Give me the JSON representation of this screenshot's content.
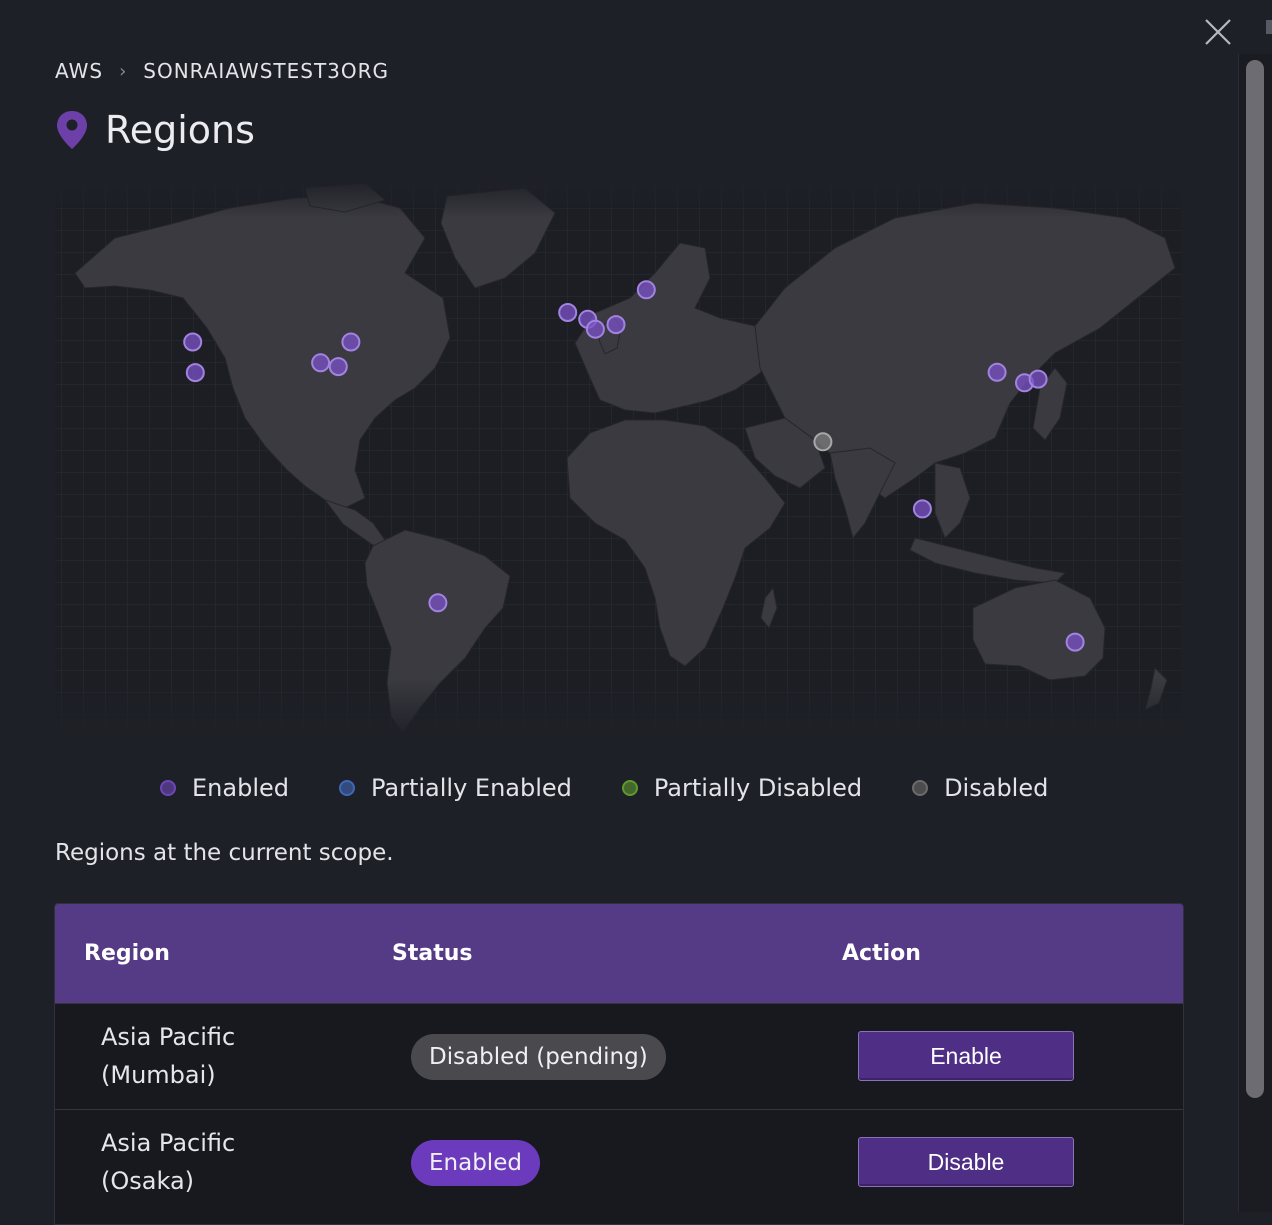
{
  "breadcrumb": {
    "items": [
      "AWS",
      "SONRAIAWSTEST3ORG"
    ],
    "separator": "›"
  },
  "page": {
    "title": "Regions",
    "icon": "map-pin-icon"
  },
  "map": {
    "icon": "world-map",
    "markers": [
      {
        "status": "enabled",
        "lat": 59.3,
        "lon": 18.1
      },
      {
        "status": "enabled",
        "lat": 53.3,
        "lon": -6.3
      },
      {
        "status": "enabled",
        "lat": 51.5,
        "lon": -0.1
      },
      {
        "status": "enabled",
        "lat": 48.9,
        "lon": 2.3
      },
      {
        "status": "enabled",
        "lat": 50.1,
        "lon": 8.7
      },
      {
        "status": "enabled",
        "lat": 45.5,
        "lon": -122.7
      },
      {
        "status": "enabled",
        "lat": 37.4,
        "lon": -121.9
      },
      {
        "status": "enabled",
        "lat": 39.0,
        "lon": -77.5
      },
      {
        "status": "enabled",
        "lat": 40.0,
        "lon": -83.0
      },
      {
        "status": "enabled",
        "lat": 45.5,
        "lon": -73.6
      },
      {
        "status": "enabled",
        "lat": -23.5,
        "lon": -46.6
      },
      {
        "status": "disabled",
        "lat": 19.1,
        "lon": 72.9
      },
      {
        "status": "enabled",
        "lat": 1.35,
        "lon": 103.8
      },
      {
        "status": "enabled",
        "lat": 37.5,
        "lon": 127.0
      },
      {
        "status": "enabled",
        "lat": 34.7,
        "lon": 135.5
      },
      {
        "status": "enabled",
        "lat": 35.7,
        "lon": 139.7
      },
      {
        "status": "enabled",
        "lat": -33.9,
        "lon": 151.2
      }
    ]
  },
  "legend": [
    {
      "label": "Enabled",
      "color": "#6e47b8"
    },
    {
      "label": "Partially Enabled",
      "color": "#3f68b8"
    },
    {
      "label": "Partially Disabled",
      "color": "#5e9a2e"
    },
    {
      "label": "Disabled",
      "color": "#6b6b6b"
    }
  ],
  "status_colors": {
    "enabled": "#7b52c7",
    "disabled": "#7d7d7d"
  },
  "scope_text": "Regions at the current scope.",
  "table": {
    "headers": {
      "region": "Region",
      "status": "Status",
      "action": "Action"
    },
    "rows": [
      {
        "region_line1": "Asia Pacific",
        "region_line2": "(Mumbai)",
        "status": "Disabled (pending)",
        "status_kind": "disabled",
        "action": "Enable"
      },
      {
        "region_line1": "Asia Pacific",
        "region_line2": "(Osaka)",
        "status": "Enabled",
        "status_kind": "enabled",
        "action": "Disable"
      }
    ]
  },
  "close_icon": "close-icon"
}
